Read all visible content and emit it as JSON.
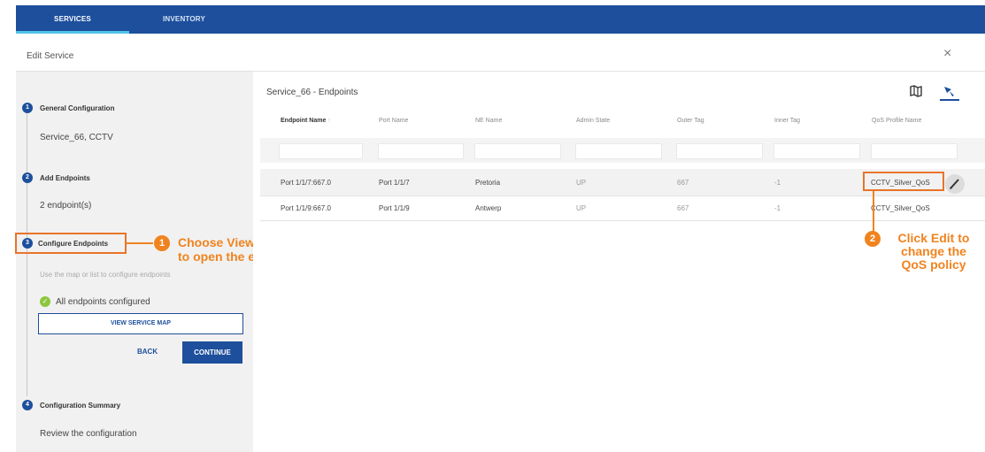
{
  "tabs": [
    {
      "label": "SERVICES",
      "active": true
    },
    {
      "label": "INVENTORY",
      "active": false
    }
  ],
  "dialog": {
    "title": "Edit Service",
    "close_glyph": "×"
  },
  "steps": [
    {
      "number": "1",
      "title": "General Configuration",
      "subtitle": "Service_66, CCTV"
    },
    {
      "number": "2",
      "title": "Add Endpoints",
      "subtitle": "2 endpoint(s)"
    },
    {
      "number": "3",
      "title": "Configure Endpoints",
      "hint": "Use the map or list to configure endpoints",
      "status": "All endpoints configured"
    },
    {
      "number": "4",
      "title": "Configuration Summary",
      "subtitle": "Review the configuration"
    }
  ],
  "buttons": {
    "view_map": "VIEW SERVICE MAP",
    "back": "BACK",
    "continue": "CONTINUE"
  },
  "endpoints": {
    "title": "Service_66 - Endpoints",
    "columns": [
      "Endpoint Name",
      "Port Name",
      "NE Name",
      "Admin State",
      "Outer Tag",
      "Inner Tag",
      "QoS Profile Name"
    ],
    "sort_glyph": "↑",
    "rows": [
      [
        "Port 1/1/7:667.0",
        "Port 1/1/7",
        "Pretoria",
        "UP",
        "667",
        "-1",
        "CCTV_Silver_QoS"
      ],
      [
        "Port 1/1/9:667.0",
        "Port 1/1/9",
        "Antwerp",
        "UP",
        "667",
        "-1",
        "CCTV_Silver_QoS"
      ]
    ]
  },
  "callouts": [
    {
      "number": "1",
      "text_lines": [
        "Choose View Endpoints",
        "to open the endpoints list"
      ]
    },
    {
      "number": "2",
      "text_lines": [
        "Click Edit to",
        "change the",
        "QoS policy"
      ]
    }
  ],
  "icons": {
    "map_view": "map-icon",
    "list_view": "list-icon",
    "edit": "pencil-icon",
    "check": "check-circle-icon"
  },
  "colors": {
    "brand_blue": "#1d4f9c",
    "callout_orange": "#f0831e",
    "success_green": "#8cc63f"
  }
}
